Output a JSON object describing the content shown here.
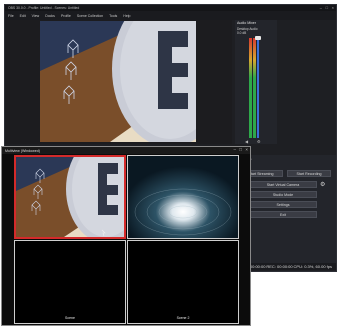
{
  "main_window": {
    "title": "OBS 30.0.0 - Profile: Untitled - Scenes: Untitled",
    "menu": [
      "File",
      "Edit",
      "View",
      "Docks",
      "Profile",
      "Scene Collection",
      "Tools",
      "Help"
    ]
  },
  "mixer": {
    "title": "Audio Mixer",
    "source_name": "Desktop Audio",
    "level": "0.0 dB"
  },
  "controls": {
    "title": "Controls",
    "start_streaming": "Start Streaming",
    "start_recording": "Start Recording",
    "start_virtual_camera": "Start Virtual Camera",
    "studio_mode": "Studio Mode",
    "settings": "Settings",
    "exit": "Exit"
  },
  "status": {
    "live": "LIVE: 00:00:00",
    "rec": "REC: 00:00:00",
    "cpu": "CPU: 0.3%, 60.00 fps"
  },
  "multiview": {
    "title": "Multiview (Windowed)",
    "bottom_left_label": "Scene",
    "bottom_right_label": "Scene 2"
  },
  "colors": {
    "program_border": "#d42a2a",
    "accent": "#3b6fd6"
  }
}
